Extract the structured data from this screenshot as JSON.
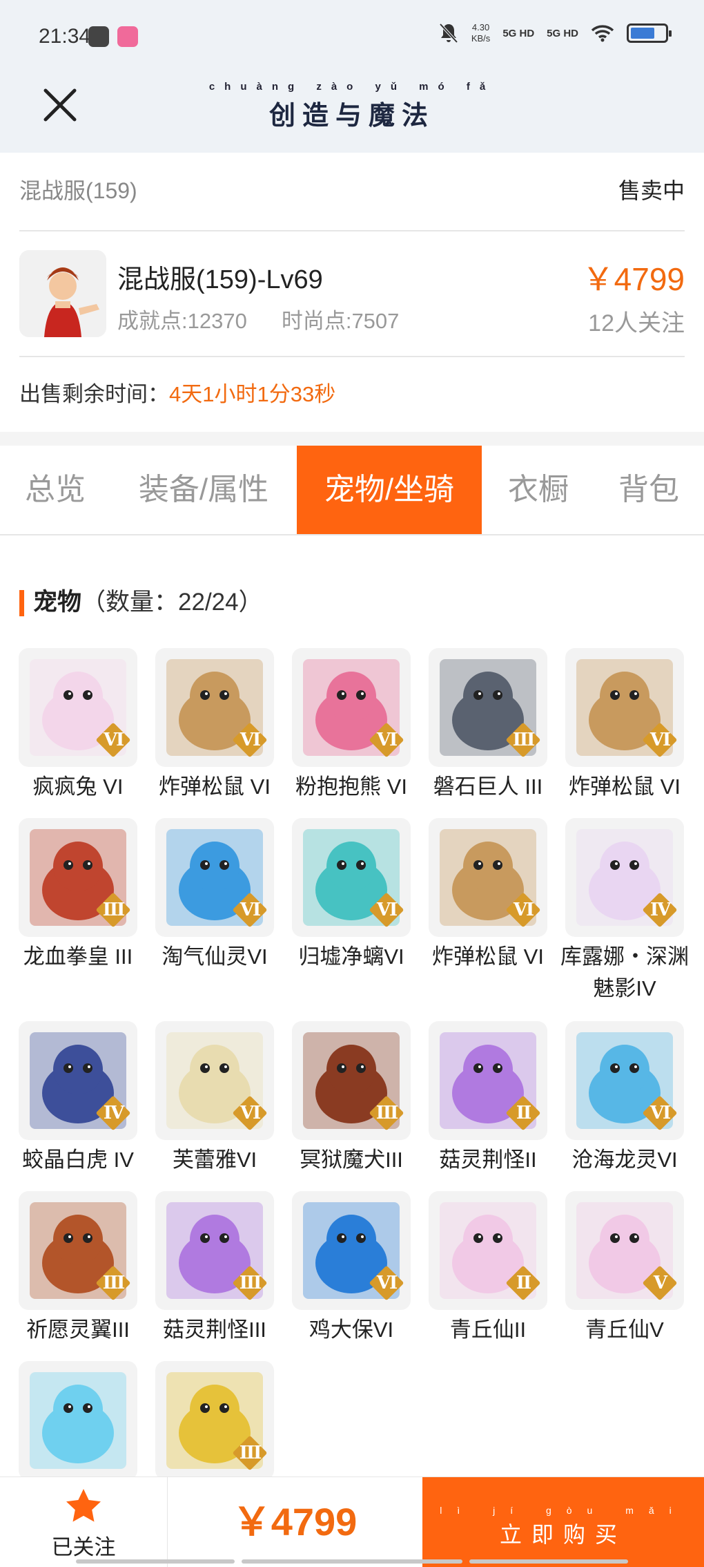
{
  "status_bar": {
    "time": "21:34",
    "net_speed_value": "4.30",
    "net_speed_unit": "KB/s",
    "sim1": "5G HD",
    "sim2": "5G HD",
    "battery_level": 0.7
  },
  "header": {
    "logo_pinyin": "chuàng zào yǔ mó fǎ",
    "logo_text": "创造与魔法"
  },
  "listing": {
    "server": "混战服(159)",
    "status": "售卖中",
    "character_title": "混战服(159)-Lv69",
    "achievement": "成就点:12370",
    "fashion": "时尚点:7507",
    "price": "￥4799",
    "watchers": "12人关注",
    "remaining_label": "出售剩余时间：",
    "remaining_value": "4天1小时1分33秒"
  },
  "tabs": [
    "总览",
    "装备/属性",
    "宠物/坐骑",
    "衣橱",
    "背包"
  ],
  "active_tab": "宠物/坐骑",
  "pets_section": {
    "title": "宠物",
    "count": "（数量：22/24）"
  },
  "pets": [
    {
      "name": "疯疯兔 VI",
      "level": "VI",
      "color": "#f3d6ea"
    },
    {
      "name": "炸弹松鼠 VI",
      "level": "VI",
      "color": "#c89a5e"
    },
    {
      "name": "粉抱抱熊 VI",
      "level": "VI",
      "color": "#e8739a"
    },
    {
      "name": "磐石巨人 III",
      "level": "III",
      "color": "#5a6270"
    },
    {
      "name": "炸弹松鼠 VI",
      "level": "VI",
      "color": "#c89a5e"
    },
    {
      "name": "龙血拳皇 III",
      "level": "III",
      "color": "#c0452f"
    },
    {
      "name": "淘气仙灵VI",
      "level": "VI",
      "color": "#3c9be0"
    },
    {
      "name": "归墟净螭VI",
      "level": "VI",
      "color": "#47c2c2"
    },
    {
      "name": "炸弹松鼠 VI",
      "level": "VI",
      "color": "#c89a5e"
    },
    {
      "name": "库露娜・深渊魅影IV",
      "level": "IV",
      "color": "#e9d6f2"
    },
    {
      "name": "蛟晶白虎 IV",
      "level": "IV",
      "color": "#3d4f9a"
    },
    {
      "name": "芙蕾雅VI",
      "level": "VI",
      "color": "#e8dcb0"
    },
    {
      "name": "冥狱魔犬III",
      "level": "III",
      "color": "#8a3b22"
    },
    {
      "name": "菇灵荆怪II",
      "level": "II",
      "color": "#b07ae0"
    },
    {
      "name": "沧海龙灵VI",
      "level": "VI",
      "color": "#57b7e6"
    },
    {
      "name": "祈愿灵翼III",
      "level": "III",
      "color": "#b3552a"
    },
    {
      "name": "菇灵荆怪III",
      "level": "III",
      "color": "#b07ae0"
    },
    {
      "name": "鸡大保VI",
      "level": "VI",
      "color": "#2a7ed8"
    },
    {
      "name": "青丘仙II",
      "level": "II",
      "color": "#f1c9e6"
    },
    {
      "name": "青丘仙V",
      "level": "V",
      "color": "#f1c9e6"
    },
    {
      "name": "",
      "level": "",
      "color": "#6fd0ef"
    },
    {
      "name": "",
      "level": "III",
      "color": "#e6c23a"
    }
  ],
  "bottom_bar": {
    "follow_label": "已关注",
    "price": "￥4799",
    "buy_pinyin": "lì jí gòu mǎi",
    "buy_label": "立即购买"
  },
  "colors": {
    "accent": "#ff6410",
    "price": "#f26a10",
    "header_bg": "#eef2f6"
  }
}
